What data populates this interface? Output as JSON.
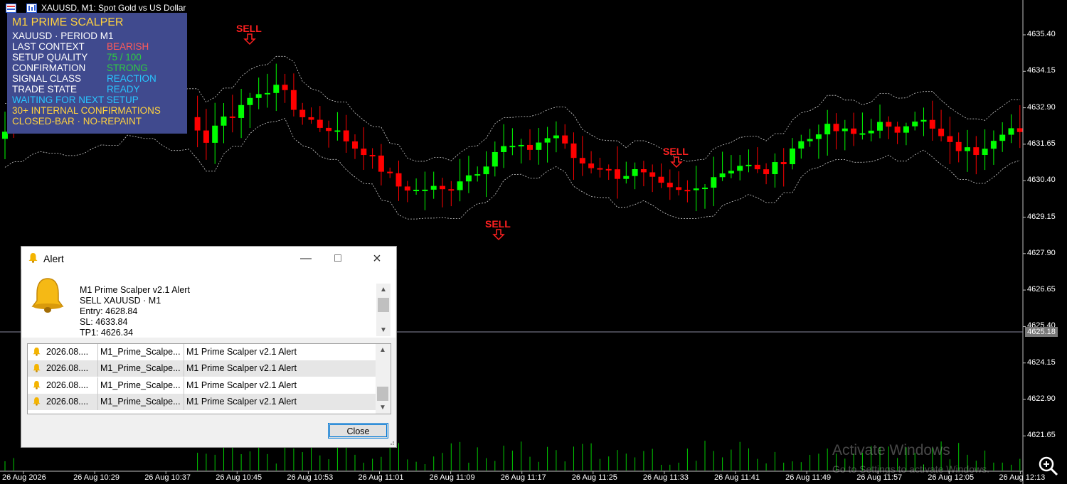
{
  "window": {
    "title": "XAUUSD, M1:  Spot Gold vs US Dollar"
  },
  "panel": {
    "title": "M1 PRIME SCALPER",
    "subtitle": "XAUUSD · PERIOD M1",
    "rows": [
      {
        "label": "LAST CONTEXT",
        "value": "BEARISH",
        "color": "#ff5a5a"
      },
      {
        "label": "SETUP QUALITY",
        "value": "75 / 100",
        "color": "#2ecc40"
      },
      {
        "label": "CONFIRMATION",
        "value": "STRONG",
        "color": "#2ecc40"
      },
      {
        "label": "SIGNAL CLASS",
        "value": "REACTION",
        "color": "#29c5ff"
      },
      {
        "label": "TRADE STATE",
        "value": "READY",
        "color": "#29c5ff"
      }
    ],
    "notes": [
      {
        "text": "WAITING FOR NEXT SETUP",
        "color": "#29c5ff"
      },
      {
        "text": "30+ INTERNAL CONFIRMATIONS",
        "color": "#ffd23f"
      },
      {
        "text": "CLOSED-BAR · NO-REPAINT",
        "color": "#ffd23f"
      }
    ]
  },
  "signals": [
    "SELL",
    "SELL",
    "SELL"
  ],
  "price_axis": {
    "labels": [
      "4635.40",
      "4634.15",
      "4632.90",
      "4631.65",
      "4630.40",
      "4629.15",
      "4627.90",
      "4626.65",
      "4625.40",
      "4624.15",
      "4622.90",
      "4621.65"
    ],
    "current_price": "4625.18"
  },
  "time_axis": {
    "labels": [
      "26 Aug 2026",
      "26 Aug 10:29",
      "26 Aug 10:37",
      "26 Aug 10:45",
      "26 Aug 10:53",
      "26 Aug 11:01",
      "26 Aug 11:09",
      "26 Aug 11:17",
      "26 Aug 11:25",
      "26 Aug 11:33",
      "26 Aug 11:41",
      "26 Aug 11:49",
      "26 Aug 11:57",
      "26 Aug 12:05",
      "26 Aug 12:13"
    ]
  },
  "alert_dialog": {
    "title": "Alert",
    "message": {
      "line1": "M1 Prime Scalper v2.1 Alert",
      "line2": "SELL XAUUSD · M1",
      "line3": "Entry: 4628.84",
      "line4": "SL: 4633.84",
      "line5": "TP1: 4626.34"
    },
    "rows": [
      {
        "time": "2026.08....",
        "source": "M1_Prime_Scalpe...",
        "message": "M1 Prime Scalper v2.1 Alert"
      },
      {
        "time": "2026.08....",
        "source": "M1_Prime_Scalpe...",
        "message": "M1 Prime Scalper v2.1 Alert"
      },
      {
        "time": "2026.08....",
        "source": "M1_Prime_Scalpe...",
        "message": "M1 Prime Scalper v2.1 Alert"
      },
      {
        "time": "2026.08....",
        "source": "M1_Prime_Scalpe...",
        "message": "M1 Prime Scalper v2.1 Alert"
      }
    ],
    "close_label": "Close"
  },
  "watermark": {
    "line1": "Activate Windows",
    "line2": "Go to Settings to activate Windows."
  },
  "colors": {
    "bull": "#00ff00",
    "bear": "#ff0000",
    "sell_signal": "#ff2020",
    "panel_bg": "#404a8e",
    "volume": "#00cc00"
  },
  "icons": {
    "zoom": "magnifier-icon",
    "bell": "bell-icon"
  }
}
